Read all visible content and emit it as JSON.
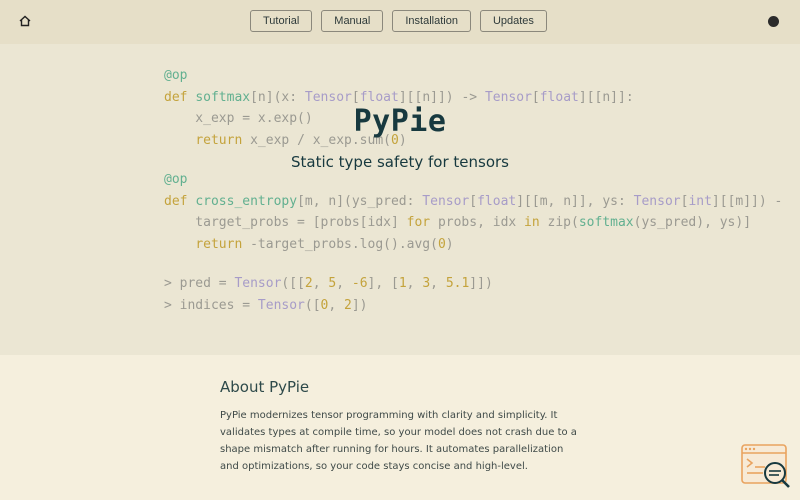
{
  "nav": {
    "home_icon": "home-icon",
    "buttons": [
      "Tutorial",
      "Manual",
      "Installation",
      "Updates"
    ],
    "theme_icon": "theme-toggle-icon"
  },
  "hero": {
    "title": "PyPie",
    "subtitle": "Static type safety for tensors",
    "code": [
      [
        {
          "t": "@op",
          "c": "dec"
        }
      ],
      [
        {
          "t": "def ",
          "c": "kw"
        },
        {
          "t": "softmax",
          "c": "fn"
        },
        {
          "t": "[n](x: ",
          "c": ""
        },
        {
          "t": "Tensor",
          "c": "ty"
        },
        {
          "t": "[",
          "c": ""
        },
        {
          "t": "float",
          "c": "ty"
        },
        {
          "t": "][[n]]) -> ",
          "c": ""
        },
        {
          "t": "Tensor",
          "c": "ty"
        },
        {
          "t": "[",
          "c": ""
        },
        {
          "t": "float",
          "c": "ty"
        },
        {
          "t": "][[n]]:",
          "c": ""
        }
      ],
      [
        {
          "t": "    x_exp = x.exp()",
          "c": ""
        }
      ],
      [
        {
          "t": "    ",
          "c": ""
        },
        {
          "t": "return",
          "c": "kw"
        },
        {
          "t": " x_exp / x_exp.sum(",
          "c": ""
        },
        {
          "t": "0",
          "c": "num"
        },
        {
          "t": ")",
          "c": ""
        }
      ],
      [],
      [
        {
          "t": "@op",
          "c": "dec"
        }
      ],
      [
        {
          "t": "def ",
          "c": "kw"
        },
        {
          "t": "cross_entropy",
          "c": "fn"
        },
        {
          "t": "[m, n](ys_pred: ",
          "c": ""
        },
        {
          "t": "Tensor",
          "c": "ty"
        },
        {
          "t": "[",
          "c": ""
        },
        {
          "t": "float",
          "c": "ty"
        },
        {
          "t": "][[m, n]], ys: ",
          "c": ""
        },
        {
          "t": "Tensor",
          "c": "ty"
        },
        {
          "t": "[",
          "c": ""
        },
        {
          "t": "int",
          "c": "ty"
        },
        {
          "t": "][[m]]) -",
          "c": ""
        }
      ],
      [
        {
          "t": "    target_probs = [probs[idx] ",
          "c": ""
        },
        {
          "t": "for",
          "c": "kw"
        },
        {
          "t": " probs, idx ",
          "c": ""
        },
        {
          "t": "in",
          "c": "kw"
        },
        {
          "t": " zip(",
          "c": ""
        },
        {
          "t": "softmax",
          "c": "fn"
        },
        {
          "t": "(ys_pred), ys)]",
          "c": ""
        }
      ],
      [
        {
          "t": "    ",
          "c": ""
        },
        {
          "t": "return",
          "c": "kw"
        },
        {
          "t": " -target_probs.log().avg(",
          "c": ""
        },
        {
          "t": "0",
          "c": "num"
        },
        {
          "t": ")",
          "c": ""
        }
      ],
      [],
      [
        {
          "t": "> pred = ",
          "c": ""
        },
        {
          "t": "Tensor",
          "c": "ty"
        },
        {
          "t": "([[",
          "c": ""
        },
        {
          "t": "2",
          "c": "num"
        },
        {
          "t": ", ",
          "c": ""
        },
        {
          "t": "5",
          "c": "num"
        },
        {
          "t": ", ",
          "c": ""
        },
        {
          "t": "-6",
          "c": "num"
        },
        {
          "t": "], [",
          "c": ""
        },
        {
          "t": "1",
          "c": "num"
        },
        {
          "t": ", ",
          "c": ""
        },
        {
          "t": "3",
          "c": "num"
        },
        {
          "t": ", ",
          "c": ""
        },
        {
          "t": "5.1",
          "c": "num"
        },
        {
          "t": "]])",
          "c": ""
        }
      ],
      [
        {
          "t": "> indices = ",
          "c": ""
        },
        {
          "t": "Tensor",
          "c": "ty"
        },
        {
          "t": "([",
          "c": ""
        },
        {
          "t": "0",
          "c": "num"
        },
        {
          "t": ", ",
          "c": ""
        },
        {
          "t": "2",
          "c": "num"
        },
        {
          "t": "])",
          "c": ""
        }
      ]
    ]
  },
  "about": {
    "title": "About PyPie",
    "text": "PyPie modernizes tensor programming with clarity and simplicity. It validates types at compile time, so your model does not crash due to a shape mismatch after running for hours. It automates parallelization and optimizations, so your code stays concise and high-level."
  },
  "corner_icon": "code-search-icon",
  "colors": {
    "nav_bg": "#e6dfc8",
    "hero_bg": "#ebe6d3",
    "about_bg": "#f5efdd",
    "title": "#17393f",
    "keyword": "#c4a33c",
    "function": "#62b090",
    "type": "#a79cc8",
    "accent_orange": "#e9a35f"
  }
}
